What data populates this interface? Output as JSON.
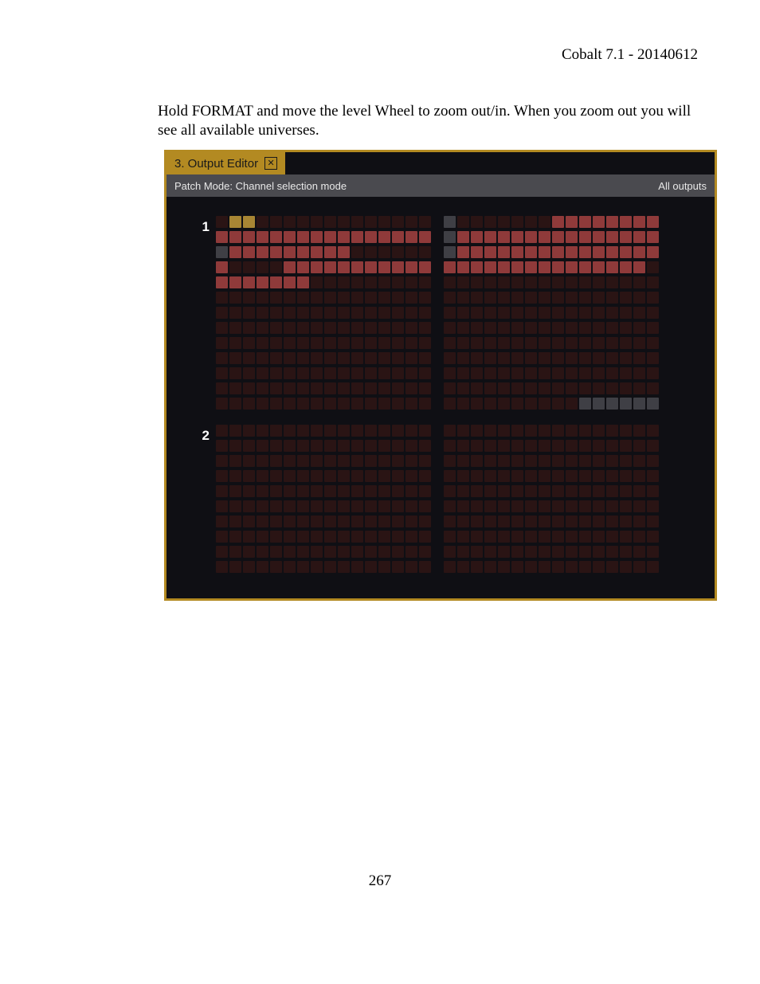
{
  "doc": {
    "header": "Cobalt 7.1 - 20140612",
    "body": "Hold FORMAT and move the level Wheel to zoom out/in. When you zoom out you will see all available universes.",
    "page_number": "267"
  },
  "app": {
    "tab_title": "3. Output Editor",
    "patch_mode": "Patch Mode: Channel selection mode",
    "outputs_label": "All outputs",
    "universes": {
      "u1": "1",
      "u2": "2"
    },
    "grid": {
      "cols_per_half": 16,
      "universe1_rows": [
        "kyykkkkkkkkkkkkk|gkkkkkkkrrrrrrrr",
        "rrrrrrrrrrrrrrrr|grrrrrrrrrrrrrrr",
        "grrrrrrrrrkkkkkk|grrrrrrrrrrrrrrr",
        "rkkkkrrrrrrrrrrr|rrrrrrrrrrrrrrrk",
        "rrrrrrrkkkkkkkkk|kkkkkkkkkkkkkkkk",
        "kkkkkkkkkkkkkkkk|kkkkkkkkkkkkkkkk",
        "kkkkkkkkkkkkkkkk|kkkkkkkkkkkkkkkk",
        "kkkkkkkkkkkkkkkk|kkkkkkkkkkkkkkkk",
        "kkkkkkkkkkkkkkkk|kkkkkkkkkkkkkkkk",
        "kkkkkkkkkkkkkkkk|kkkkkkkkkkkkkkkk",
        "kkkkkkkkkkkkkkkk|kkkkkkkkkkkkkkkk",
        "kkkkkkkkkkkkkkkk|kkkkkkkkkkkkkkkk",
        "kkkkkkkkkkkkkkkk|kkkkkkkkkkgggggg"
      ],
      "universe2_rows": [
        "kkkkkkkkkkkkkkkk|kkkkkkkkkkkkkkkk",
        "kkkkkkkkkkkkkkkk|kkkkkkkkkkkkkkkk",
        "kkkkkkkkkkkkkkkk|kkkkkkkkkkkkkkkk",
        "kkkkkkkkkkkkkkkk|kkkkkkkkkkkkkkkk",
        "kkkkkkkkkkkkkkkk|kkkkkkkkkkkkkkkk",
        "kkkkkkkkkkkkkkkk|kkkkkkkkkkkkkkkk",
        "kkkkkkkkkkkkkkkk|kkkkkkkkkkkkkkkk",
        "kkkkkkkkkkkkkkkk|kkkkkkkkkkkkkkkk",
        "kkkkkkkkkkkkkkkk|kkkkkkkkkkkkkkkk",
        "kkkkkkkkkkkkkkkk|kkkkkkkkkkkkkkkk"
      ]
    }
  }
}
